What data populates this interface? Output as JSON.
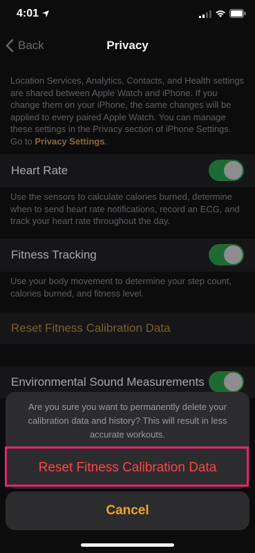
{
  "status_bar": {
    "time": "4:01"
  },
  "nav": {
    "back_label": "Back",
    "title": "Privacy"
  },
  "intro": {
    "text": "Location Services, Analytics, Contacts, and Health settings are shared between Apple Watch and iPhone. If you change them on your iPhone, the same changes will be applied to every paired Apple Watch. You can manage these settings in the Privacy section of iPhone Settings. Go to ",
    "link": "Privacy Settings",
    "suffix": "."
  },
  "settings": {
    "heart_rate": {
      "label": "Heart Rate",
      "enabled": true,
      "description": "Use the sensors to calculate calories burned, determine when to send heart rate notifications, record an ECG, and track your heart rate throughout the day."
    },
    "fitness_tracking": {
      "label": "Fitness Tracking",
      "enabled": true,
      "description": "Use your body movement to determine your step count, calories burned, and fitness level."
    },
    "reset_link": "Reset Fitness Calibration Data",
    "environmental": {
      "label": "Environmental Sound Measurements",
      "enabled": true
    }
  },
  "action_sheet": {
    "message": "Are you sure you want to permanently delete your calibration data and history? This will result in less accurate workouts.",
    "destructive_label": "Reset Fitness Calibration Data",
    "cancel_label": "Cancel"
  },
  "colors": {
    "toggle_on": "#1f6a34",
    "destructive": "#ff4444",
    "cancel": "#f0a32a",
    "highlight_box": "#e4246b"
  }
}
